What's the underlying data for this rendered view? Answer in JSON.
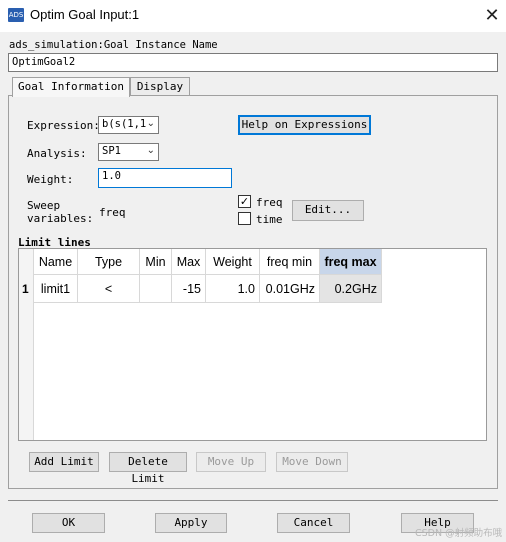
{
  "window": {
    "icon": "ads-app-icon",
    "icon_text": "ADS",
    "title": "Optim Goal Input:1",
    "close_glyph": "✕"
  },
  "instance": {
    "label": "ads_simulation:Goal Instance Name",
    "value": "OptimGoal2"
  },
  "tabs": [
    {
      "label": "Goal Information",
      "active": true
    },
    {
      "label": "Display",
      "active": false
    }
  ],
  "goal": {
    "expression_label": "Expression:",
    "expression_value": "b(s(1,1",
    "help_expressions": "Help on Expressions",
    "analysis_label": "Analysis:",
    "analysis_value": "SP1",
    "weight_label": "Weight:",
    "weight_value": "1.0",
    "sweep_label_line1": "Sweep",
    "sweep_label_line2": "variables:",
    "sweep_value": "freq",
    "sweep_options": [
      {
        "label": "freq",
        "checked": true
      },
      {
        "label": "time",
        "checked": false
      }
    ],
    "edit_button": "Edit..."
  },
  "limits": {
    "title": "Limit lines",
    "columns": [
      "Name",
      "Type",
      "Min",
      "Max",
      "Weight",
      "freq min",
      "freq max"
    ],
    "rows": [
      {
        "index": "1",
        "cells": [
          "limit1",
          "<",
          "",
          "-15",
          "1.0",
          "0.01GHz",
          "0.2GHz"
        ]
      }
    ],
    "buttons": {
      "add": "Add Limit",
      "delete": "Delete Limit",
      "move_up": "Move Up",
      "move_down": "Move Down"
    }
  },
  "footer": {
    "ok": "OK",
    "apply": "Apply",
    "cancel": "Cancel",
    "help": "Help",
    "watermark": "CSDN @射频助布哦"
  },
  "colors": {
    "focus_border": "#0078d7",
    "selected_header": "#c8d6ea"
  }
}
